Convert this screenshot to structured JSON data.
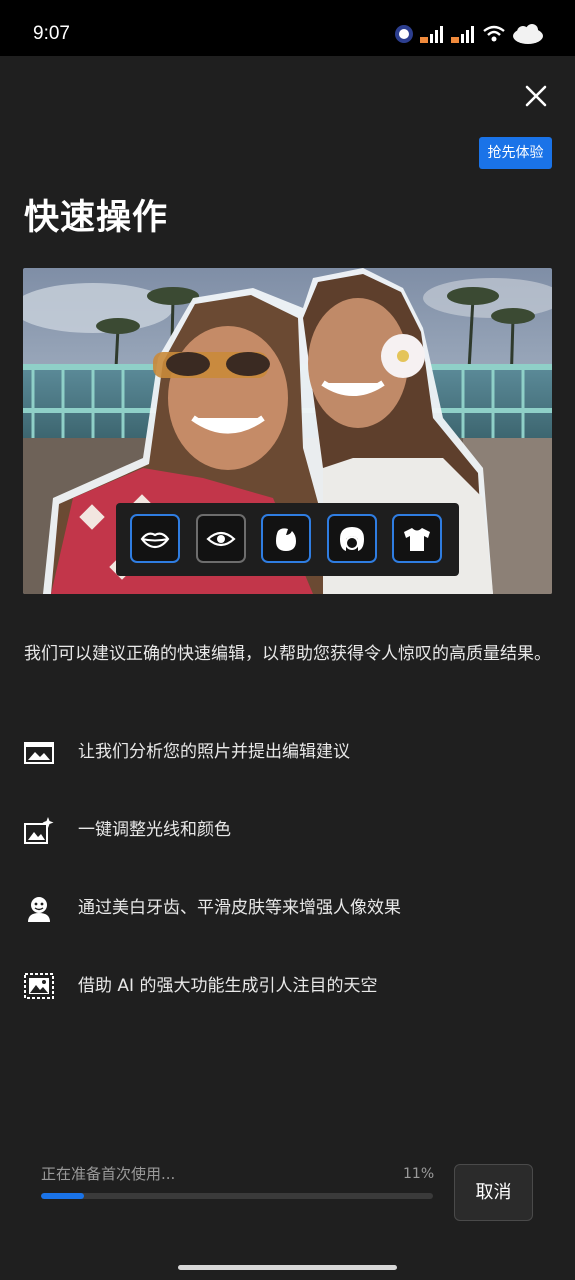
{
  "status_bar": {
    "time": "9:07",
    "icons": [
      "notification-badge-icon",
      "signal-icon",
      "signal-icon",
      "signal-icon",
      "wifi-icon",
      "battery-cloud-icon"
    ]
  },
  "header": {
    "close_icon": "close-icon",
    "early_access_label": "抢先体验",
    "title": "快速操作"
  },
  "hero": {
    "tools": [
      {
        "name": "lips-icon",
        "active": true
      },
      {
        "name": "eye-icon",
        "active": false
      },
      {
        "name": "face-icon",
        "active": true
      },
      {
        "name": "hair-icon",
        "active": true
      },
      {
        "name": "shirt-icon",
        "active": true
      }
    ]
  },
  "description": "我们可以建议正确的快速编辑，以帮助您获得令人惊叹的高质量结果。",
  "features": [
    {
      "icon": "photo-analyze-icon",
      "label": "让我们分析您的照片并提出编辑建议"
    },
    {
      "icon": "photo-sparkle-icon",
      "label": "一键调整光线和颜色"
    },
    {
      "icon": "portrait-icon",
      "label": "通过美白牙齿、平滑皮肤等来增强人像效果"
    },
    {
      "icon": "sky-select-icon",
      "label": "借助 AI 的强大功能生成引人注目的天空"
    }
  ],
  "progress": {
    "label": "正在准备首次使用...",
    "percent_text": "11%",
    "value": 0.11
  },
  "cancel_label": "取消",
  "colors": {
    "background": "#1f1f1f",
    "accent": "#1a73e8",
    "tool_border": "#2f7de1"
  }
}
